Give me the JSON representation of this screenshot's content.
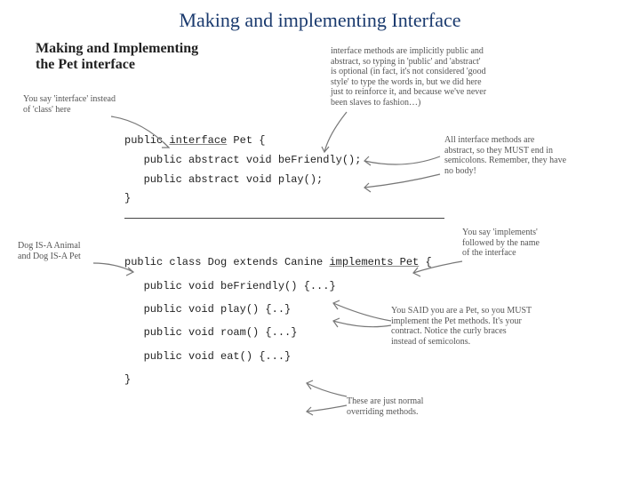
{
  "title": "Making and implementing Interface",
  "head1_l1": "Making and Implementing",
  "head1_l2": "the Pet interface",
  "ann_interface_l1": "You say 'interface' instead",
  "ann_interface_l2": "of 'class' here",
  "ann_implicit_l1": "interface methods are implicitly public and",
  "ann_implicit_l2": "abstract, so typing in 'public' and 'abstract'",
  "ann_implicit_l3": "is optional (in fact, it's not considered 'good",
  "ann_implicit_l4": "style' to type the words in, but we did here",
  "ann_implicit_l5": "just to reinforce it, and because we've never",
  "ann_implicit_l6": "been slaves to fashion…)",
  "ann_must_l1": "All interface methods are",
  "ann_must_l2": "abstract, so they MUST end in",
  "ann_must_l3": "semicolons. Remember, they have",
  "ann_must_l4": "no body!",
  "ann_isa_l1": "Dog IS-A Animal",
  "ann_isa_l2": "and Dog IS-A Pet",
  "ann_impl_l1": "You say 'implements'",
  "ann_impl_l2": "followed by the name",
  "ann_impl_l3": "of the interface",
  "ann_must2_l1": "You SAID you are a Pet, so you MUST",
  "ann_must2_l2": "implement the Pet methods. It's your",
  "ann_must2_l3": "contract. Notice the curly braces",
  "ann_must2_l4": "instead of semicolons.",
  "ann_override_l1": "These are just normal",
  "ann_override_l2": "overriding methods.",
  "code1_l1a": "public ",
  "code1_l1b": "interface",
  "code1_l1c": " Pet {",
  "code1_l2": "   public abstract void beFriendly();",
  "code1_l3": "   public abstract void play();",
  "code1_l4": "}",
  "code2_l1a": "public class Dog extends Canine ",
  "code2_l1b": "implements Pet",
  "code2_l1c": " {",
  "code2_l2": "   public void beFriendly() {...}",
  "code2_l3": "   public void play() {..}",
  "code2_l4": "   public void roam() {...}",
  "code2_l5": "   public void eat() {...}",
  "code2_l6": "}"
}
